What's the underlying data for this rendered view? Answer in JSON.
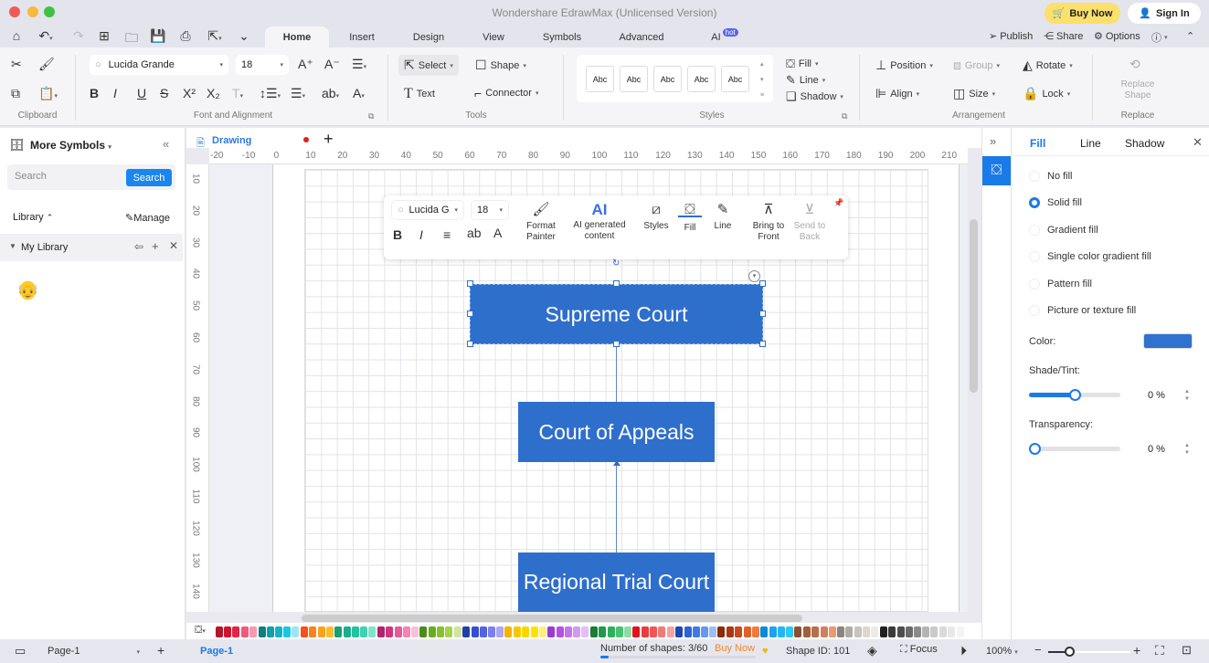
{
  "window": {
    "title": "Wondershare EdrawMax (Unlicensed Version)",
    "buy_now": "Buy Now",
    "sign_in": "Sign In"
  },
  "menu_tabs": [
    {
      "label": "Home",
      "active": true
    },
    {
      "label": "Insert"
    },
    {
      "label": "Design"
    },
    {
      "label": "View"
    },
    {
      "label": "Symbols"
    },
    {
      "label": "Advanced"
    },
    {
      "label": "AI",
      "badge": "hot"
    }
  ],
  "top_right": {
    "publish": "Publish",
    "share": "Share",
    "options": "Options"
  },
  "ribbon": {
    "clipboard_label": "Clipboard",
    "font_label": "Font and Alignment",
    "font_family": "Lucida Grande",
    "font_size": "18",
    "tools_label": "Tools",
    "select": "Select",
    "shape": "Shape",
    "text": "Text",
    "connector": "Connector",
    "styles_label": "Styles",
    "style_swatches": [
      "Abc",
      "Abc",
      "Abc",
      "Abc",
      "Abc"
    ],
    "fill": "Fill",
    "line": "Line",
    "shadow": "Shadow",
    "arrangement_label": "Arrangement",
    "position": "Position",
    "group": "Group",
    "rotate": "Rotate",
    "align": "Align",
    "size": "Size",
    "lock": "Lock",
    "replace_label": "Replace",
    "replace_shape": "Replace Shape"
  },
  "left_panel": {
    "title": "More Symbols",
    "search_placeholder": "Search",
    "search_button": "Search",
    "library": "Library",
    "manage": "Manage",
    "my_library": "My Library"
  },
  "document": {
    "tab": "Drawing"
  },
  "rulers": {
    "horizontal": [
      "-20",
      "-10",
      "0",
      "10",
      "20",
      "30",
      "40",
      "50",
      "60",
      "70",
      "80",
      "90",
      "100",
      "110",
      "120",
      "130",
      "140",
      "150",
      "160",
      "170",
      "180",
      "190",
      "200",
      "210"
    ],
    "vertical": [
      "10",
      "20",
      "30",
      "40",
      "50",
      "60",
      "70",
      "80",
      "90",
      "100",
      "110",
      "120",
      "130",
      "140"
    ]
  },
  "floating_toolbar": {
    "font": "Lucida G",
    "size": "18",
    "format_painter": "Format Painter",
    "ai_content": "AI generated content",
    "ai_glyph": "AI",
    "styles": "Styles",
    "fill": "Fill",
    "line": "Line",
    "bring_front": "Bring to Front",
    "send_back": "Send to Back"
  },
  "diagram": {
    "shapes": [
      {
        "id": "supreme",
        "label": "Supreme Court",
        "selected": true
      },
      {
        "id": "appeals",
        "label": "Court of Appeals"
      },
      {
        "id": "trial",
        "label": "Regional Trial Court"
      }
    ],
    "fill_color": "#2f6fcc"
  },
  "right_panel": {
    "tabs": [
      "Fill",
      "Line",
      "Shadow"
    ],
    "active_tab": "Fill",
    "fill_options": [
      "No fill",
      "Solid fill",
      "Gradient fill",
      "Single color gradient fill",
      "Pattern fill",
      "Picture or texture fill"
    ],
    "selected_option": "Solid fill",
    "color_label": "Color:",
    "color_value": "#2f72d0",
    "shade_label": "Shade/Tint:",
    "shade_value": "0 %",
    "shade_slider_fraction": 0.5,
    "transparency_label": "Transparency:",
    "transparency_value": "0 %",
    "transparency_slider_fraction": 0.0
  },
  "palette": [
    "#b5162b",
    "#d0142f",
    "#e0244a",
    "#ee5a7a",
    "#f49bb0",
    "#0e7f80",
    "#10a0a8",
    "#13b4c8",
    "#1cc6e0",
    "#9de6f2",
    "#f4511e",
    "#f7831f",
    "#f9a21f",
    "#fbbf2a",
    "#1a9e76",
    "#17b08b",
    "#24c29f",
    "#3fd1b0",
    "#7ee5cc",
    "#b0236a",
    "#d0337f",
    "#e55b9a",
    "#f084b4",
    "#f7c1d6",
    "#4a8c1c",
    "#6aac21",
    "#86c22f",
    "#a5d24d",
    "#cfe59a",
    "#1f3fa8",
    "#3550cc",
    "#5064e0",
    "#7a80f0",
    "#a8a8f5",
    "#f4b400",
    "#f8c700",
    "#fad600",
    "#fde400",
    "#fef080",
    "#9b3ad0",
    "#b452e0",
    "#c575ea",
    "#d499ef",
    "#e4bff5",
    "#1c7a3a",
    "#1f9a4a",
    "#2bb05c",
    "#45c272",
    "#8edba6",
    "#e0141c",
    "#ec3a3a",
    "#f05656",
    "#f27878",
    "#f6a3a0",
    "#1d48b0",
    "#2c63d0",
    "#3f7ae6",
    "#6399ef",
    "#9ebdf5",
    "#8b2a0a",
    "#a83a12",
    "#c84a20",
    "#e0602c",
    "#f07a3a",
    "#0b8ad8",
    "#1aa3f0",
    "#22b6f6",
    "#2cc8fa",
    "#8b5030",
    "#a0603a",
    "#b8704a",
    "#d08060",
    "#e89a70",
    "#8a8580",
    "#b0aca4",
    "#c8c4bc",
    "#dcd8d0",
    "#ecebe6",
    "#202020",
    "#3a3a3a",
    "#4d4d4d",
    "#6a6a6a",
    "#8a8a8a",
    "#b4b4b4",
    "#cacaca",
    "#dadada",
    "#e8e8e8",
    "#f4f4f4"
  ],
  "status_bar": {
    "page_selector": "Page-1",
    "active_page": "Page-1",
    "shape_count": "Number of shapes: 3/60",
    "buy_now": "Buy Now",
    "shape_id": "Shape ID: 101",
    "focus": "Focus",
    "zoom": "100%",
    "zoom_slider_fraction": 0.25
  }
}
